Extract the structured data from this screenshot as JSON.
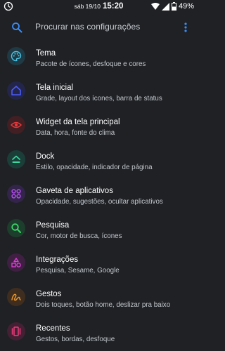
{
  "status_bar": {
    "date": "sáb 19/10",
    "time": "15:20",
    "battery": "49%"
  },
  "search": {
    "placeholder": "Procurar nas configurações"
  },
  "items": [
    {
      "title": "Tema",
      "subtitle": "Pacote de ícones, desfoque e cores",
      "icon": "palette-icon",
      "color": "#4ec7e8",
      "bg": "#1f3a44"
    },
    {
      "title": "Tela inicial",
      "subtitle": "Grade, layout dos ícones, barra de status",
      "icon": "home-icon",
      "color": "#4d5cf5",
      "bg": "#23264a"
    },
    {
      "title": "Widget da tela principal",
      "subtitle": "Data, hora, fonte do clima",
      "icon": "eye-icon",
      "color": "#e8383b",
      "bg": "#421f23"
    },
    {
      "title": "Dock",
      "subtitle": "Estilo, opacidade, indicador de página",
      "icon": "dock-icon",
      "color": "#3fd6a0",
      "bg": "#1b3e39"
    },
    {
      "title": "Gaveta de aplicativos",
      "subtitle": "Opacidade, sugestões, ocultar aplicativos",
      "icon": "apps-icon",
      "color": "#b04ee8",
      "bg": "#33244a"
    },
    {
      "title": "Pesquisa",
      "subtitle": "Cor, motor de busca, ícones",
      "icon": "search-icon",
      "color": "#3ed46a",
      "bg": "#1d3e2c"
    },
    {
      "title": "Integrações",
      "subtitle": "Pesquisa, Sesame, Google",
      "icon": "integrations-icon",
      "color": "#d63fd0",
      "bg": "#3f2043"
    },
    {
      "title": "Gestos",
      "subtitle": "Dois toques, botão home, deslizar pra baixo",
      "icon": "gesture-icon",
      "color": "#e8962e",
      "bg": "#3f2e1f"
    },
    {
      "title": "Recentes",
      "subtitle": "Gestos, bordas, desfoque",
      "icon": "recents-icon",
      "color": "#ef3a7a",
      "bg": "#432033"
    }
  ]
}
